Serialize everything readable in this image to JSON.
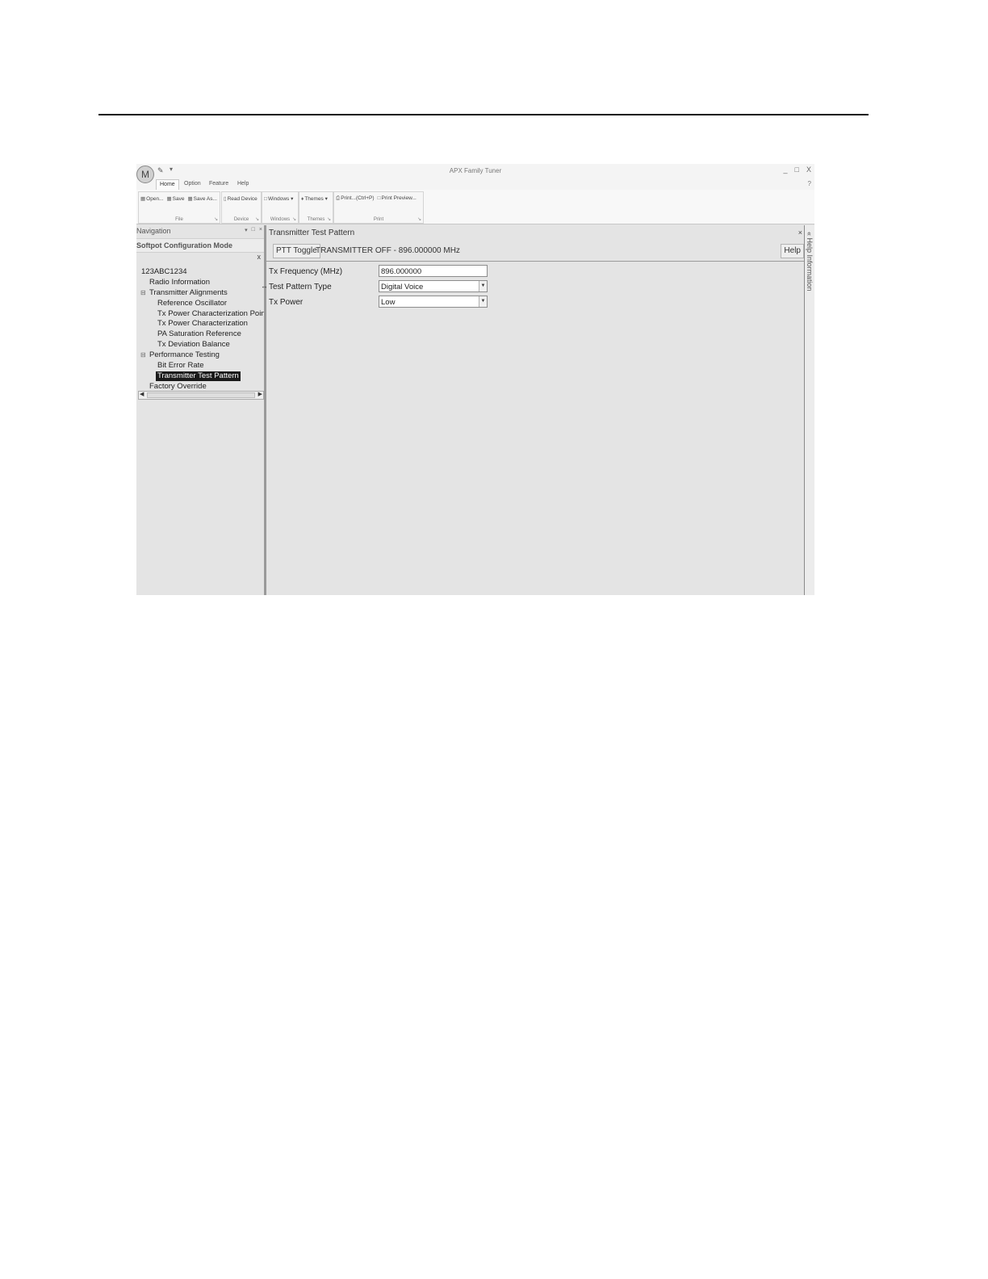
{
  "app": {
    "title": "APX Family Tuner",
    "logo_icon": "motorola-logo-icon",
    "quick_access_icon": "quick-access-icon",
    "window_controls": [
      "_",
      "□",
      "X"
    ]
  },
  "ribbon": {
    "tabs": [
      "Home",
      "Option",
      "Feature",
      "Help"
    ],
    "active_tab": "Home",
    "groups": {
      "file": {
        "caption": "File",
        "open": "Open...",
        "save": "Save",
        "save_as": "Save As..."
      },
      "device": {
        "caption": "Device",
        "read_device": "Read Device"
      },
      "windows": {
        "caption": "Windows",
        "windows": "Windows"
      },
      "themes": {
        "caption": "Themes",
        "themes": "Themes"
      },
      "print": {
        "caption": "Print",
        "print": "Print...(Ctrl+P)",
        "print_preview": "Print Preview..."
      }
    }
  },
  "navigation": {
    "title": "Navigation",
    "mode": "Softpot Configuration Mode",
    "close": "x",
    "tree": {
      "root": "123ABC1234",
      "radio_information": "Radio Information",
      "transmitter_alignments": "Transmitter Alignments",
      "reference_oscillator": "Reference Oscillator",
      "tx_power_char_points": "Tx Power Characterization Points",
      "tx_power_char": "Tx Power Characterization",
      "pa_saturation": "PA Saturation Reference",
      "tx_deviation": "Tx Deviation Balance",
      "performance_testing": "Performance Testing",
      "bit_error_rate": "Bit Error Rate",
      "transmitter_test_pattern": "Transmitter Test Pattern",
      "factory_override": "Factory Override"
    },
    "selected": "Transmitter Test Pattern"
  },
  "content": {
    "title": "Transmitter Test Pattern",
    "close": "×",
    "ptt_label": "PTT Toggle",
    "status": "TRANSMITTER OFF - 896.000000 MHz",
    "help_label": "Help",
    "fields": {
      "tx_frequency": {
        "label": "Tx Frequency (MHz)",
        "value": "896.000000"
      },
      "test_pattern_type": {
        "label": "Test Pattern Type",
        "value": "Digital Voice"
      },
      "tx_power": {
        "label": "Tx Power",
        "value": "Low"
      }
    }
  },
  "help_panel": {
    "label": "Help Information"
  }
}
